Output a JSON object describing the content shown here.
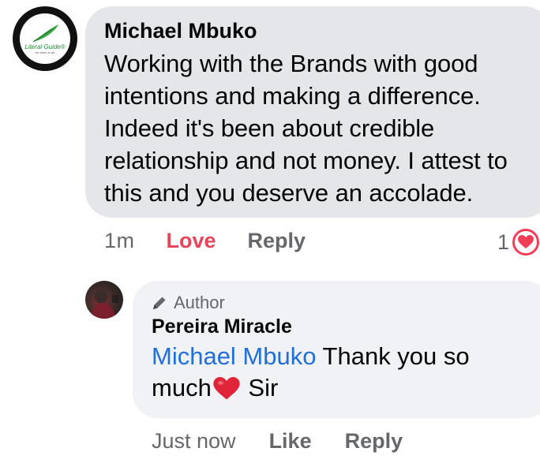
{
  "comment": {
    "avatar": {
      "logo_text": "Literal Guide®",
      "logo_tagline": "...be seen to all..."
    },
    "author": "Michael Mbuko",
    "text": "Working with the Brands with good intentions and making a difference. Indeed it's been about credible relationship and not money. I attest to this and you deserve an accolade.",
    "time": "1m",
    "love_label": "Love",
    "reply_label": "Reply",
    "reaction_count": "1",
    "reaction_icon": "heart-icon"
  },
  "reply": {
    "badge_icon": "pencil-icon",
    "badge_label": "Author",
    "author": "Pereira Miracle",
    "mention": "Michael Mbuko",
    "text_before_emoji": " Thank you so much",
    "emoji": "heart-emoji",
    "text_after_emoji": " Sir",
    "time": "Just now",
    "like_label": "Like",
    "reply_label": "Reply"
  },
  "colors": {
    "love_red": "#e94459",
    "mention_blue": "#216fdb",
    "bubble_gray": "#e4e6e9",
    "reply_bubble_gray": "#f0f2f5",
    "meta_gray": "#65676b"
  }
}
